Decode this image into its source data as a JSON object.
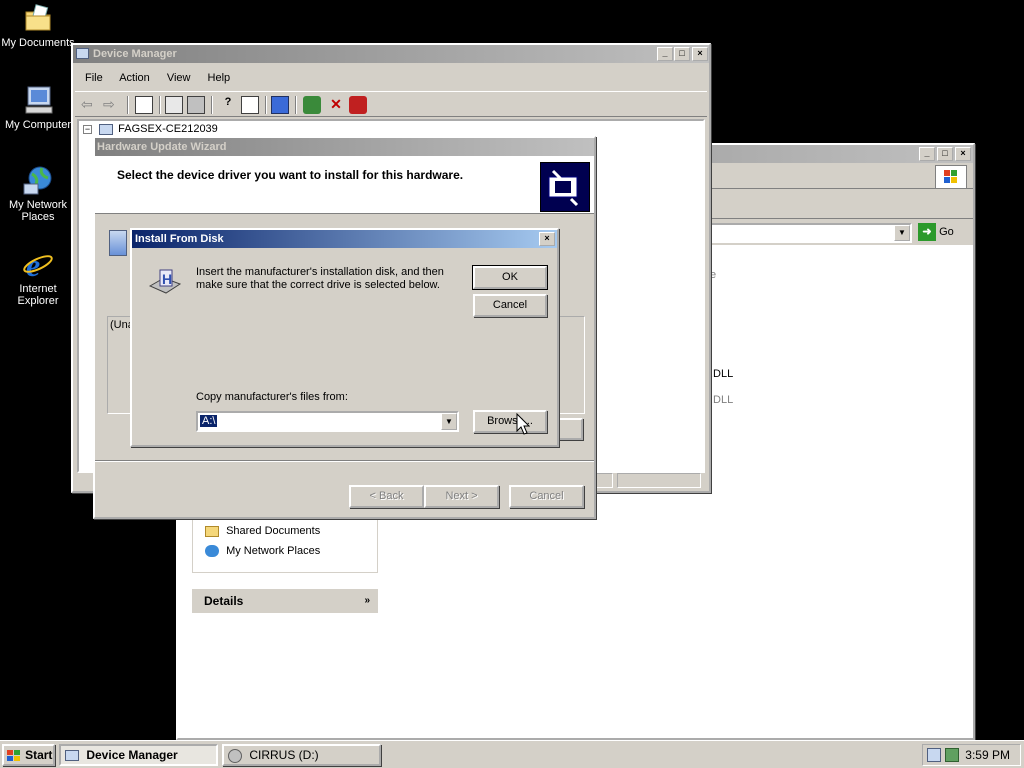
{
  "desktop": {
    "icons": [
      {
        "label": "My Documents"
      },
      {
        "label": "My Computer"
      },
      {
        "label": "My Network Places"
      },
      {
        "label": "Internet Explorer"
      }
    ]
  },
  "explorer_bg": {
    "go_label": "Go",
    "partial_text_1": "e",
    "partial_text_2": ".DLL",
    "partial_text_3": ".DLL",
    "other_places": [
      {
        "label": "Shared Documents"
      },
      {
        "label": "My Network Places"
      }
    ],
    "details_label": "Details"
  },
  "device_manager": {
    "title": "Device Manager",
    "menu": [
      "File",
      "Action",
      "View",
      "Help"
    ],
    "tree_root": "FAGSEX-CE212039"
  },
  "wizard": {
    "title": "Hardware Update Wizard",
    "heading": "Select the device driver you want to install for this hardware.",
    "list_partial": "(Una",
    "back_label": "< Back",
    "next_label": "Next >",
    "cancel_label": "Cancel"
  },
  "install_dialog": {
    "title": "Install From Disk",
    "close_label": "×",
    "message": "Insert the manufacturer's installation disk, and then make sure that the correct drive is selected below.",
    "ok_label": "OK",
    "cancel_label": "Cancel",
    "copy_label": "Copy manufacturer's files from:",
    "path_value": "A:\\",
    "browse_label": "Browse..."
  },
  "taskbar": {
    "start_label": "Start",
    "tasks": [
      {
        "label": "Device Manager"
      },
      {
        "label": "CIRRUS (D:)"
      }
    ],
    "clock": "3:59 PM"
  },
  "colors": {
    "desktop": "#000000",
    "face": "#d4d0c8",
    "active_title": "#0a246a",
    "inactive_title": "#808080"
  }
}
